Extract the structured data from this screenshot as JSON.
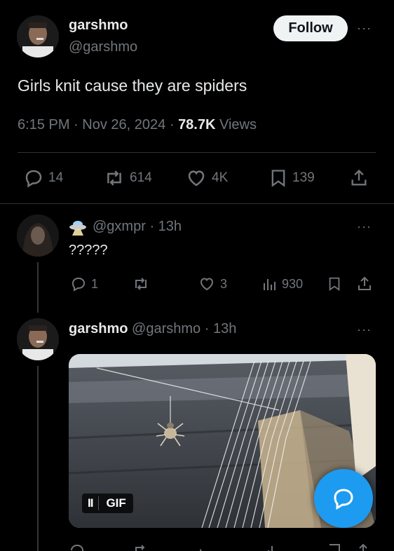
{
  "main_tweet": {
    "display_name": "garshmo",
    "handle": "@garshmo",
    "follow_label": "Follow",
    "more": "···",
    "text": "Girls knit cause they are spiders",
    "time": "6:15 PM",
    "sep1": "·",
    "date": "Nov 26, 2024",
    "sep2": "·",
    "views_count": "78.7K",
    "views_label": "Views",
    "replies": "14",
    "reposts": "614",
    "likes": "4K",
    "bookmarks": "139"
  },
  "reply1": {
    "handle": "@gxmpr",
    "sep": "·",
    "age": "13h",
    "text": "?????",
    "more": "···",
    "replies": "1",
    "likes": "3",
    "views": "930"
  },
  "reply2": {
    "display_name": "garshmo",
    "handle": "@garshmo",
    "sep": "·",
    "age": "13h",
    "more": "···",
    "gif_label": "GIF",
    "pause_label": "II"
  },
  "colors": {
    "background": "#000000",
    "text": "#e7e9ea",
    "muted": "#71767b",
    "accent_blue": "#1d9bf0"
  }
}
